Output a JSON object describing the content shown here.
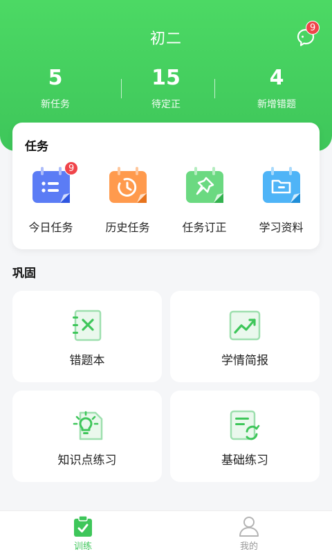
{
  "header": {
    "title": "初二",
    "message_badge": "9",
    "stats": [
      {
        "value": "5",
        "label": "新任务"
      },
      {
        "value": "15",
        "label": "待定正"
      },
      {
        "value": "4",
        "label": "新增错题"
      }
    ]
  },
  "tasks": {
    "title": "任务",
    "items": [
      {
        "label": "今日任务",
        "badge": "9",
        "icon": "calendar-list-icon",
        "color": "#5b7cf5"
      },
      {
        "label": "历史任务",
        "icon": "history-clock-icon",
        "color": "#ff9a4d"
      },
      {
        "label": "任务订正",
        "icon": "pin-icon",
        "color": "#6bd981"
      },
      {
        "label": "学习资料",
        "icon": "folder-icon",
        "color": "#4fb4f7"
      }
    ]
  },
  "consolidate": {
    "title": "巩固",
    "tiles": [
      {
        "label": "错题本",
        "icon": "error-notebook-icon"
      },
      {
        "label": "学情简报",
        "icon": "trend-chart-icon"
      },
      {
        "label": "知识点练习",
        "icon": "lightbulb-icon"
      },
      {
        "label": "基础练习",
        "icon": "refresh-doc-icon"
      }
    ]
  },
  "nav": {
    "items": [
      {
        "label": "训练",
        "icon": "clipboard-check-icon",
        "active": true
      },
      {
        "label": "我的",
        "icon": "user-icon",
        "active": false
      }
    ]
  },
  "colors": {
    "brand_green": "#3ec65a",
    "badge_red": "#f0444a"
  }
}
